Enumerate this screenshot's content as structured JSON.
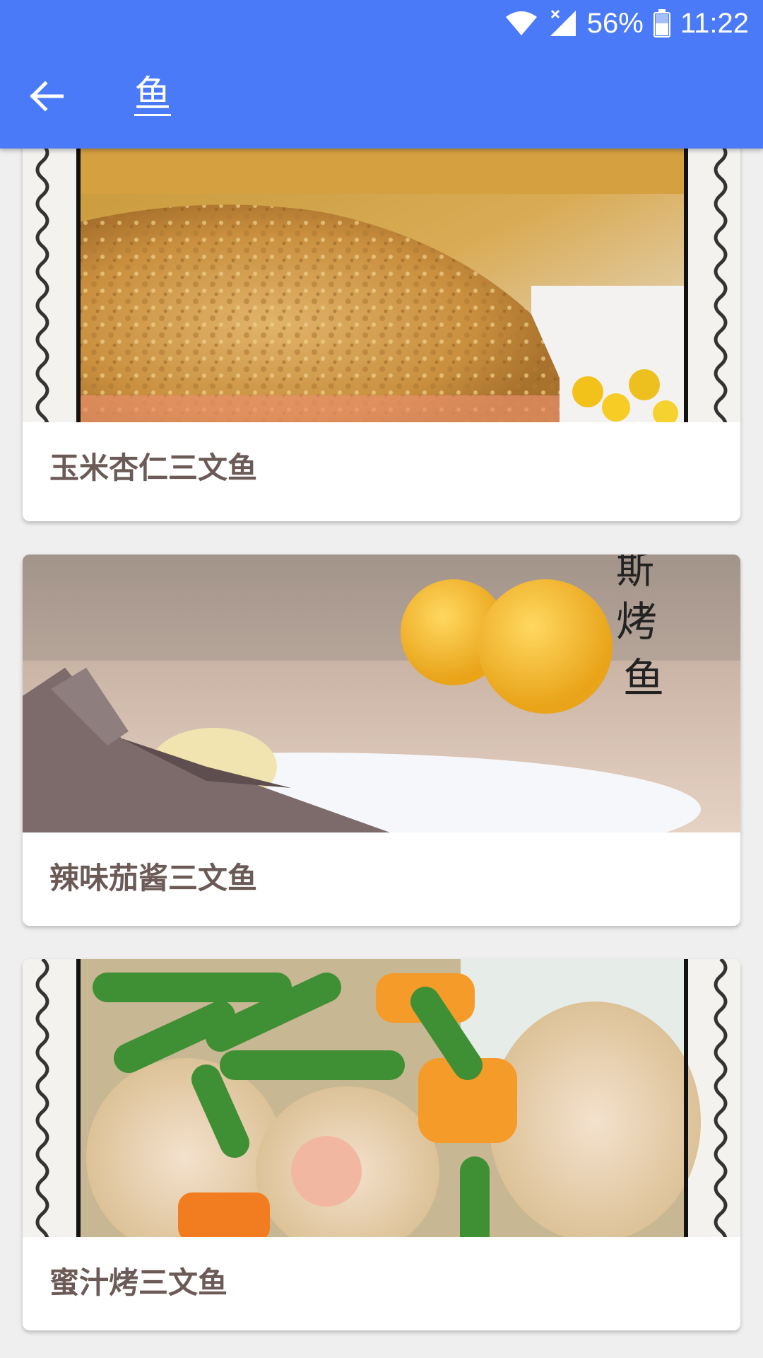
{
  "status_bar": {
    "battery_percent": "56%",
    "time": "11:22",
    "icons": [
      "wifi-icon",
      "signal-icon",
      "battery-icon"
    ]
  },
  "toolbar": {
    "title": "鱼",
    "back_icon": "arrow-back-icon"
  },
  "colors": {
    "appbar": "#4a7af7",
    "card_title": "#6b5a55",
    "background": "#efefef"
  },
  "recipes": [
    {
      "title": "玉米杏仁三文鱼",
      "image": "baked salmon with almond crust and corn, stamp-style border"
    },
    {
      "title": "辣味茄酱三文鱼",
      "image": "grilled fish with lemon slices and oranges, calligraphy watermark"
    },
    {
      "title": "蜜汁烤三文鱼",
      "image": "crusted salmon with green beans and carrots, stamp-style border"
    }
  ],
  "watermark_text": "斯烤鱼"
}
